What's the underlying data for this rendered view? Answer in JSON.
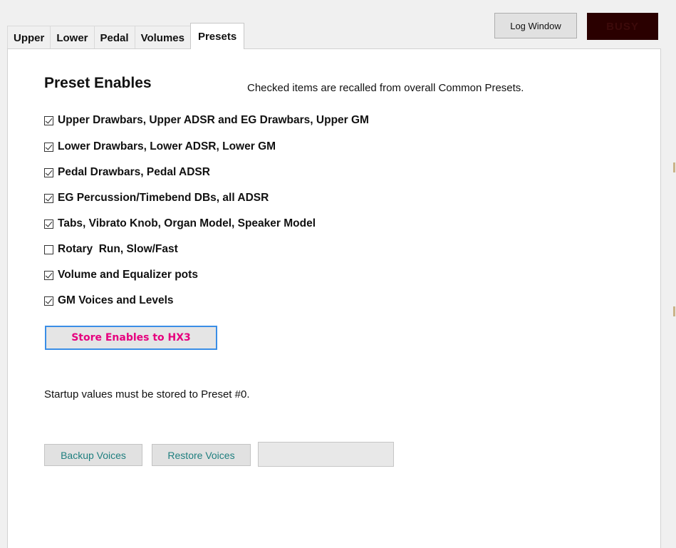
{
  "tabs": [
    {
      "label": "Upper",
      "active": false
    },
    {
      "label": "Lower",
      "active": false
    },
    {
      "label": "Pedal",
      "active": false
    },
    {
      "label": "Volumes",
      "active": false
    },
    {
      "label": "Presets",
      "active": true
    }
  ],
  "header": {
    "log_window_label": "Log Window",
    "busy_label": "BUSY"
  },
  "presets": {
    "heading": "Preset Enables",
    "hint": "Checked items are recalled from overall Common Presets.",
    "options": [
      {
        "label": "Upper Drawbars, Upper ADSR and EG Drawbars, Upper GM",
        "checked": true
      },
      {
        "label": "Lower Drawbars, Lower ADSR, Lower GM",
        "checked": true
      },
      {
        "label": "Pedal Drawbars, Pedal ADSR",
        "checked": true
      },
      {
        "label": "EG Percussion/Timebend DBs, all ADSR",
        "checked": true
      },
      {
        "label": "Tabs, Vibrato Knob, Organ Model, Speaker Model",
        "checked": true
      },
      {
        "label": "Rotary  Run, Slow/Fast",
        "checked": false
      },
      {
        "label": "Volume and Equalizer pots",
        "checked": true
      },
      {
        "label": "GM Voices and Levels",
        "checked": true
      }
    ],
    "store_button_label": "Store Enables to HX3",
    "startup_note": "Startup values must be stored to Preset #0.",
    "backup_label": "Backup Voices",
    "restore_label": "Restore Voices",
    "status_value": ""
  },
  "colors": {
    "store_text": "#e6007e",
    "store_border": "#3a8ee6",
    "small_button_text": "#1f7f7f",
    "busy_bg": "#2a0000"
  }
}
